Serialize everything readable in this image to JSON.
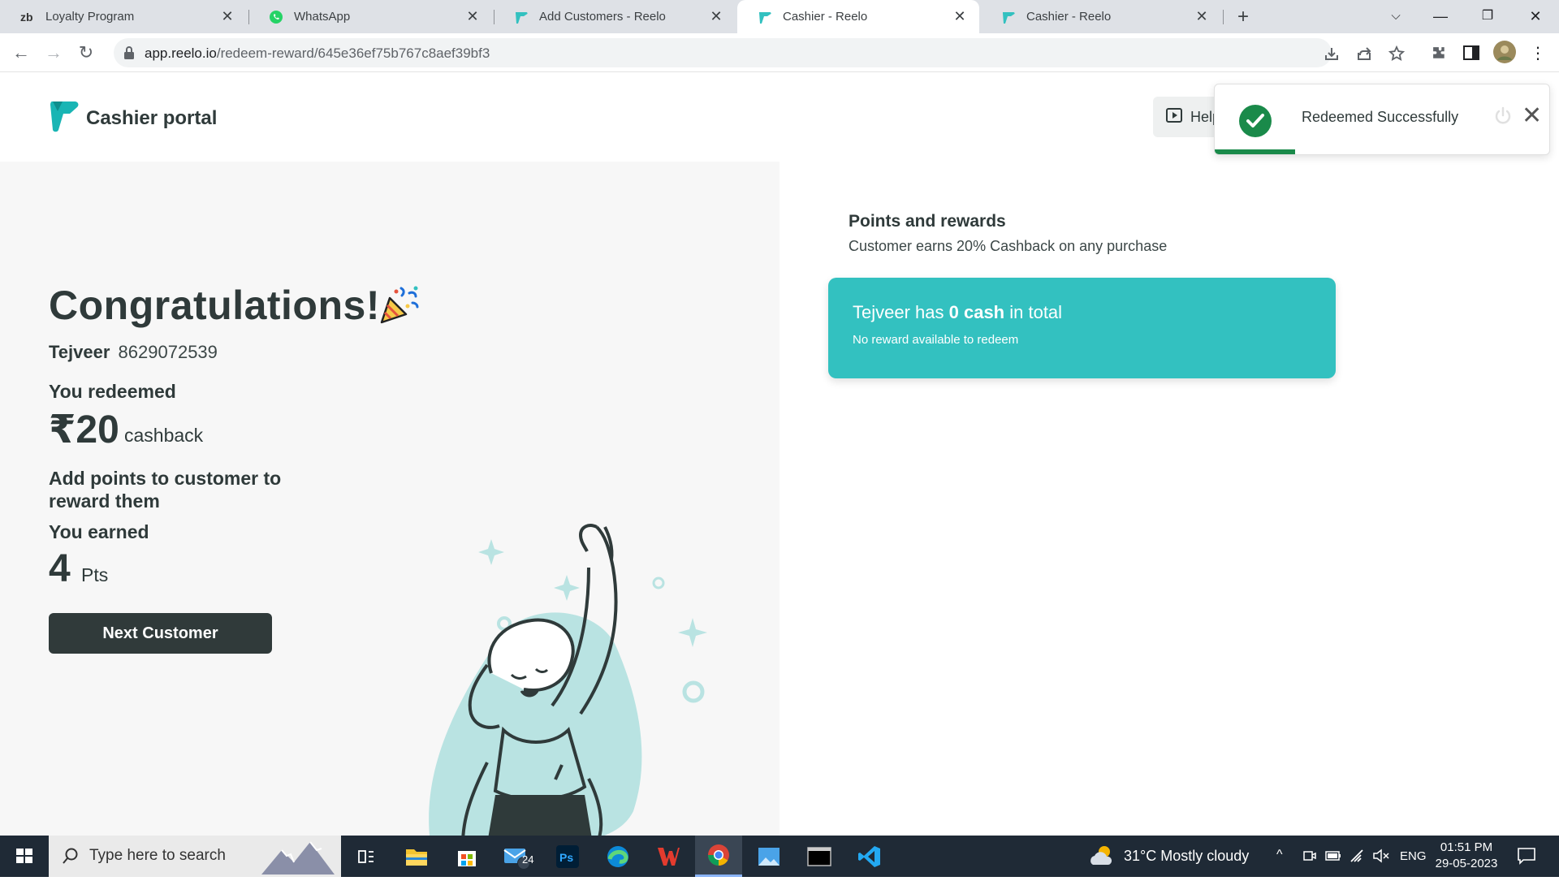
{
  "browser": {
    "tabs": [
      {
        "title": "Loyalty Program",
        "icon": "zb-icon"
      },
      {
        "title": "WhatsApp",
        "icon": "whatsapp-icon"
      },
      {
        "title": "Add Customers - Reelo",
        "icon": "reelo-icon"
      },
      {
        "title": "Cashier - Reelo",
        "icon": "reelo-icon",
        "active": true
      },
      {
        "title": "Cashier - Reelo",
        "icon": "reelo-icon"
      }
    ],
    "url_host": "app.reelo.io",
    "url_path": "/redeem-reward/645e36ef75b767c8aef39bf3"
  },
  "header": {
    "brand": "Cashier portal",
    "help_label": "Help"
  },
  "result": {
    "heading": "Congratulations!",
    "customer_name": "Tejveer",
    "customer_phone": "8629072539",
    "redeemed_label": "You redeemed",
    "redeemed_amount": "₹20",
    "redeemed_unit": "cashback",
    "add_points_label": "Add points to customer to reward them",
    "earned_label": "You earned",
    "earned_points": "4",
    "earned_unit": "Pts",
    "next_button": "Next Customer"
  },
  "rewards": {
    "title": "Points and rewards",
    "subtitle": "Customer earns 20% Cashback on any purchase",
    "card_prefix": "Tejveer has ",
    "card_amount": "0 cash",
    "card_suffix": " in total",
    "card_note": "No reward available to redeem"
  },
  "toast": {
    "message": "Redeemed Successfully",
    "progress": 0.24
  },
  "taskbar": {
    "search_placeholder": "Type here to search",
    "mail_badge": "24",
    "weather": "31°C  Mostly cloudy",
    "lang": "ENG",
    "time": "01:51 PM",
    "date": "29-05-2023"
  },
  "colors": {
    "accent": "#33c1c0",
    "dark": "#303a3a",
    "success": "#1a8a4a"
  }
}
